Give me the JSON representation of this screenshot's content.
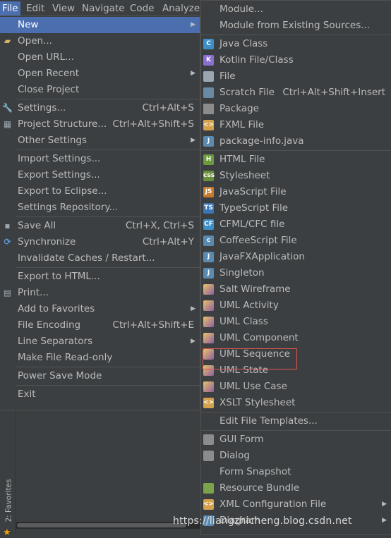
{
  "menubar": [
    "File",
    "Edit",
    "View",
    "Navigate",
    "Code",
    "Analyze"
  ],
  "file_menu": [
    {
      "label": "New",
      "sel": true,
      "arrow": true
    },
    {
      "label": "Open...",
      "icon": "folder-icon"
    },
    {
      "label": "Open URL..."
    },
    {
      "label": "Open Recent",
      "arrow": true
    },
    {
      "label": "Close Project"
    },
    {
      "sep": true
    },
    {
      "label": "Settings...",
      "shortcut": "Ctrl+Alt+S",
      "icon": "wrench-icon"
    },
    {
      "label": "Project Structure...",
      "shortcut": "Ctrl+Alt+Shift+S",
      "icon": "project-structure-icon"
    },
    {
      "label": "Other Settings",
      "arrow": true
    },
    {
      "sep": true
    },
    {
      "label": "Import Settings..."
    },
    {
      "label": "Export Settings..."
    },
    {
      "label": "Export to Eclipse..."
    },
    {
      "label": "Settings Repository..."
    },
    {
      "sep": true
    },
    {
      "label": "Save All",
      "shortcut": "Ctrl+X, Ctrl+S",
      "icon": "save-icon"
    },
    {
      "label": "Synchronize",
      "shortcut": "Ctrl+Alt+Y",
      "icon": "sync-icon"
    },
    {
      "label": "Invalidate Caches / Restart..."
    },
    {
      "sep": true
    },
    {
      "label": "Export to HTML..."
    },
    {
      "label": "Print...",
      "icon": "print-icon"
    },
    {
      "label": "Add to Favorites",
      "arrow": true
    },
    {
      "label": "File Encoding",
      "shortcut": "Ctrl+Alt+Shift+E"
    },
    {
      "label": "Line Separators",
      "arrow": true
    },
    {
      "label": "Make File Read-only"
    },
    {
      "sep": true
    },
    {
      "label": "Power Save Mode"
    },
    {
      "sep": true
    },
    {
      "label": "Exit"
    }
  ],
  "new_menu": [
    {
      "label": "Module..."
    },
    {
      "label": "Module from Existing Sources..."
    },
    {
      "sep": true
    },
    {
      "label": "Java Class",
      "icon": "java-class-icon",
      "color": "#3d8fc6",
      "glyph": "C"
    },
    {
      "label": "Kotlin File/Class",
      "icon": "kotlin-icon",
      "color": "#8a6fd1",
      "glyph": "K"
    },
    {
      "label": "File",
      "icon": "file-icon",
      "color": "#9aa7b0",
      "glyph": ""
    },
    {
      "label": "Scratch File",
      "shortcut": "Ctrl+Alt+Shift+Insert",
      "icon": "scratch-file-icon",
      "color": "#6a8aa3",
      "glyph": ""
    },
    {
      "label": "Package",
      "icon": "package-icon",
      "color": "#8c8c8c",
      "glyph": ""
    },
    {
      "label": "FXML File",
      "icon": "fxml-icon",
      "color": "#d4a24e",
      "glyph": "<>"
    },
    {
      "label": "package-info.java",
      "icon": "package-info-icon",
      "color": "#5b8ab0",
      "glyph": "J"
    },
    {
      "sep": true
    },
    {
      "label": "HTML File",
      "icon": "html-icon",
      "color": "#6c9a3c",
      "glyph": "H"
    },
    {
      "label": "Stylesheet",
      "icon": "css-icon",
      "color": "#6a8f3a",
      "glyph": "css"
    },
    {
      "label": "JavaScript File",
      "icon": "javascript-icon",
      "color": "#c57b2c",
      "glyph": "JS"
    },
    {
      "label": "TypeScript File",
      "icon": "typescript-icon",
      "color": "#3a76b5",
      "glyph": "TS"
    },
    {
      "label": "CFML/CFC file",
      "icon": "cfml-icon",
      "color": "#3d8fc6",
      "glyph": "CF"
    },
    {
      "label": "CoffeeScript File",
      "icon": "coffeescript-icon",
      "color": "#5b8ab0",
      "glyph": "c"
    },
    {
      "label": "JavaFXApplication",
      "icon": "javafx-icon",
      "color": "#5b8ab0",
      "glyph": "J"
    },
    {
      "label": "Singleton",
      "icon": "singleton-icon",
      "color": "#5b8ab0",
      "glyph": "J"
    },
    {
      "label": "Salt Wireframe",
      "icon": "uml-icon",
      "color": "#b8863b",
      "glyph": ""
    },
    {
      "label": "UML Activity",
      "icon": "uml-icon",
      "color": "#b8863b",
      "glyph": ""
    },
    {
      "label": "UML Class",
      "icon": "uml-icon",
      "color": "#b8863b",
      "glyph": ""
    },
    {
      "label": "UML Component",
      "icon": "uml-icon",
      "color": "#b8863b",
      "glyph": ""
    },
    {
      "label": "UML Sequence",
      "icon": "uml-icon",
      "color": "#b8863b",
      "glyph": ""
    },
    {
      "label": "UML State",
      "icon": "uml-icon",
      "color": "#b8863b",
      "glyph": ""
    },
    {
      "label": "UML Use Case",
      "icon": "uml-icon",
      "color": "#b8863b",
      "glyph": ""
    },
    {
      "label": "XSLT Stylesheet",
      "icon": "xslt-icon",
      "color": "#d4a24e",
      "glyph": "<>"
    },
    {
      "sep": true
    },
    {
      "label": "Edit File Templates..."
    },
    {
      "sep": true
    },
    {
      "label": "GUI Form",
      "icon": "gui-form-icon",
      "color": "#8c8c8c",
      "glyph": ""
    },
    {
      "label": "Dialog",
      "icon": "dialog-icon",
      "color": "#8c8c8c",
      "glyph": ""
    },
    {
      "label": "Form Snapshot"
    },
    {
      "label": "Resource Bundle",
      "icon": "resource-bundle-icon",
      "color": "#7aa34b",
      "glyph": ""
    },
    {
      "label": "XML Configuration File",
      "icon": "xml-config-icon",
      "color": "#d4a24e",
      "glyph": "<>",
      "arrow": true
    },
    {
      "label": "Diagram",
      "icon": "diagram-icon",
      "color": "#5b8ab0",
      "glyph": "",
      "arrow": true
    }
  ],
  "left_strip": {
    "favorites_label": "2: Favorites"
  },
  "watermark": "https://liangzhicheng.blog.csdn.net"
}
